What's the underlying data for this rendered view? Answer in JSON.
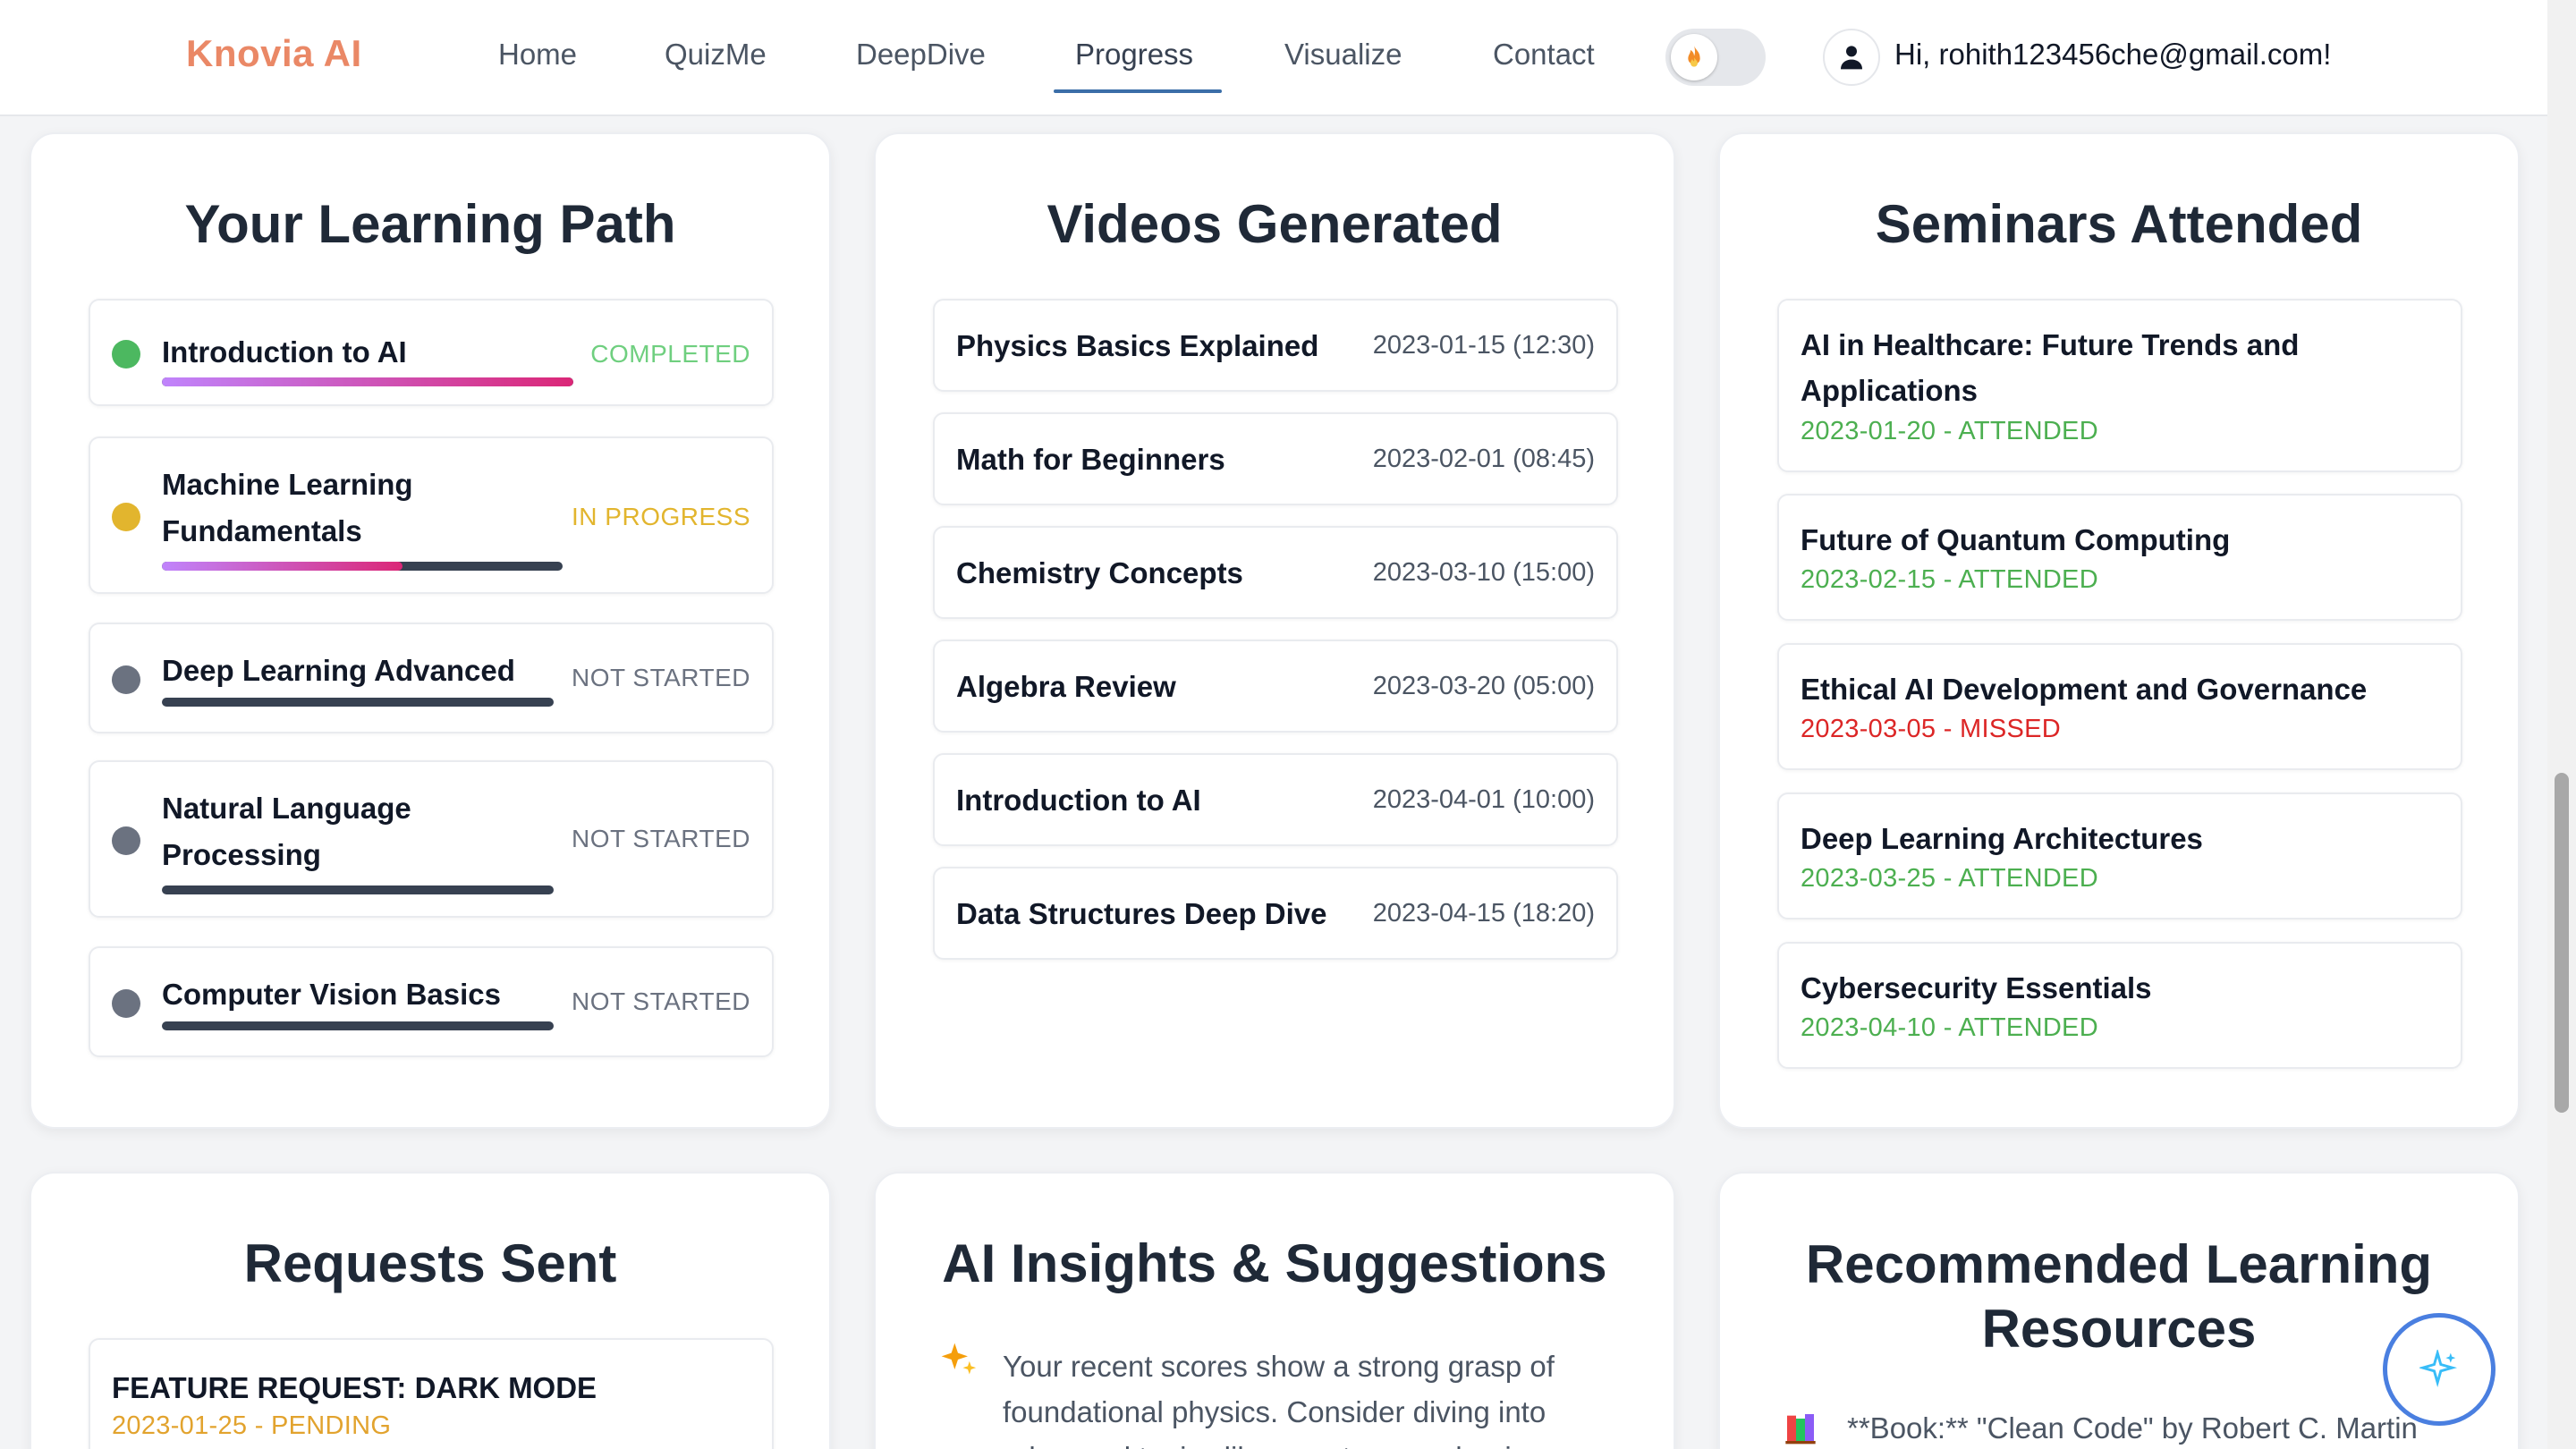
{
  "header": {
    "brand": "Knovia AI",
    "nav": [
      "Home",
      "QuizMe",
      "DeepDive",
      "Progress",
      "Visualize",
      "Contact"
    ],
    "active_nav": "Progress",
    "theme_toggle_icon": "fire-icon",
    "greeting": "Hi, rohith123456che@gmail.com!"
  },
  "learning_path": {
    "title": "Your Learning Path",
    "items": [
      {
        "title": "Introduction to AI",
        "status": "COMPLETED",
        "progress": 1.0,
        "status_color": "#6fcf7f"
      },
      {
        "title": "Machine Learning Fundamentals",
        "status": "IN PROGRESS",
        "progress": 0.6,
        "status_color": "#e2b52e"
      },
      {
        "title": "Deep Learning Advanced",
        "status": "NOT STARTED",
        "progress": 0.0,
        "status_color": "#6b7280"
      },
      {
        "title": "Natural Language Processing",
        "status": "NOT STARTED",
        "progress": 0.0,
        "status_color": "#6b7280"
      },
      {
        "title": "Computer Vision Basics",
        "status": "NOT STARTED",
        "progress": 0.0,
        "status_color": "#6b7280"
      }
    ]
  },
  "videos": {
    "title": "Videos Generated",
    "items": [
      {
        "title": "Physics Basics Explained",
        "date": "2023-01-15 (12:30)"
      },
      {
        "title": "Math for Beginners",
        "date": "2023-02-01 (08:45)"
      },
      {
        "title": "Chemistry Concepts",
        "date": "2023-03-10 (15:00)"
      },
      {
        "title": "Algebra Review",
        "date": "2023-03-20 (05:00)"
      },
      {
        "title": "Introduction to AI",
        "date": "2023-04-01 (10:00)"
      },
      {
        "title": "Data Structures Deep Dive",
        "date": "2023-04-15 (18:20)"
      }
    ]
  },
  "seminars": {
    "title": "Seminars Attended",
    "items": [
      {
        "title": "AI in Healthcare: Future Trends and Applications",
        "status": "2023-01-20 - ATTENDED",
        "status_color": "#4caf50"
      },
      {
        "title": "Future of Quantum Computing",
        "status": "2023-02-15 - ATTENDED",
        "status_color": "#4caf50"
      },
      {
        "title": "Ethical AI Development and Governance",
        "status": "2023-03-05 - MISSED",
        "status_color": "#dc2626"
      },
      {
        "title": "Deep Learning Architectures",
        "status": "2023-03-25 - ATTENDED",
        "status_color": "#4caf50"
      },
      {
        "title": "Cybersecurity Essentials",
        "status": "2023-04-10 - ATTENDED",
        "status_color": "#4caf50"
      }
    ]
  },
  "requests": {
    "title": "Requests Sent",
    "items": [
      {
        "title": "FEATURE REQUEST: DARK MODE",
        "status": "2023-01-25 - PENDING",
        "status_color": "#e2a32e"
      }
    ]
  },
  "insights": {
    "title": "AI Insights & Suggestions",
    "icon": "sparkles-icon",
    "text": "Your recent scores show a strong grasp of foundational physics. Consider diving into advanced topics like quantum mechanics"
  },
  "resources": {
    "title": "Recommended Learning Resources",
    "icon": "books-icon",
    "text": "**Book:** \"Clean Code\" by Robert C. Martin"
  },
  "fab": {
    "icon": "sparkle-icon"
  }
}
